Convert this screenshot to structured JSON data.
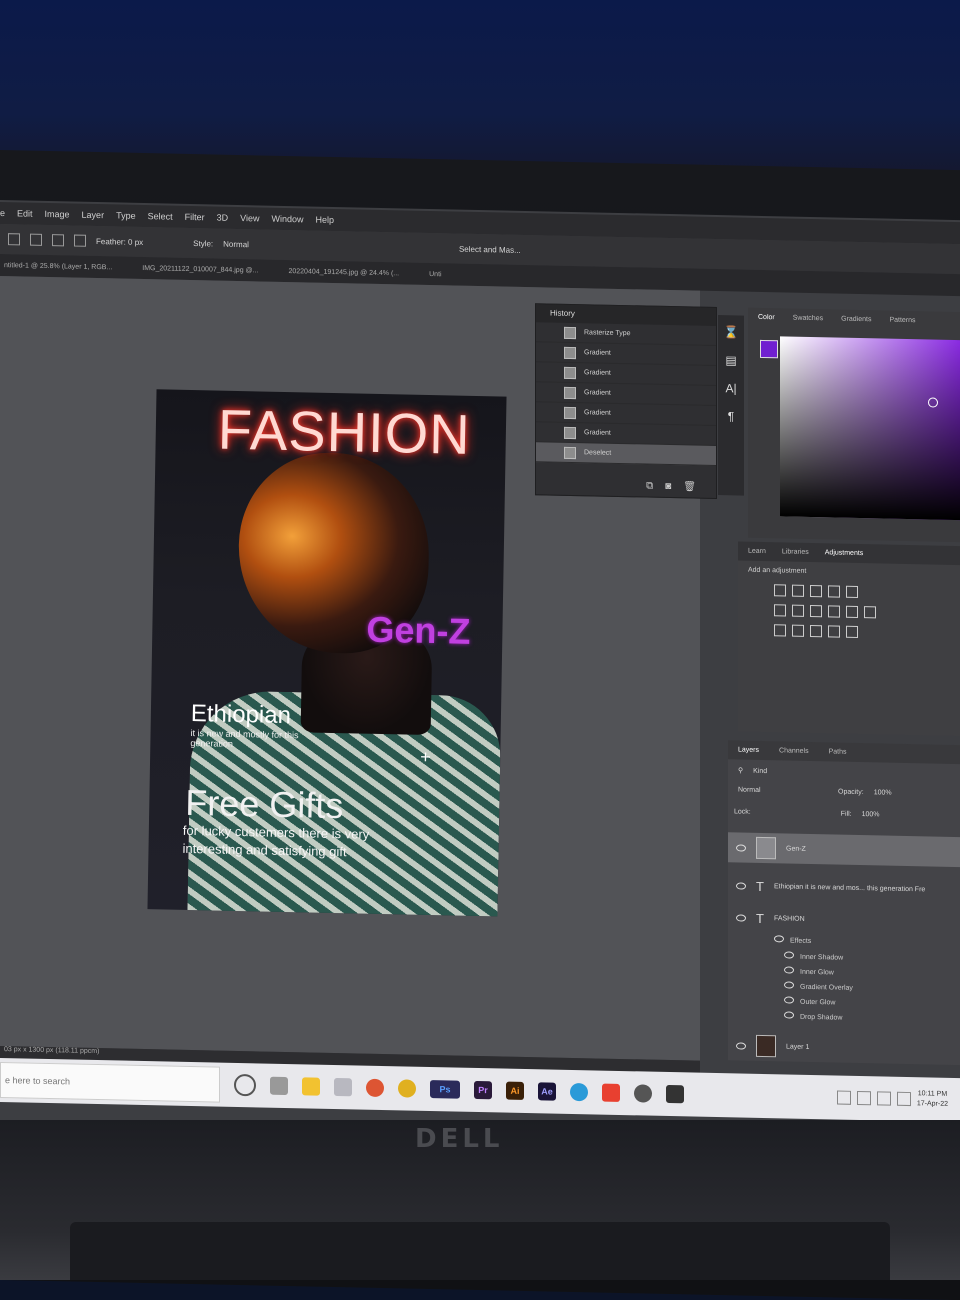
{
  "menu": [
    "e",
    "Edit",
    "Image",
    "Layer",
    "Type",
    "Select",
    "Filter",
    "3D",
    "View",
    "Window",
    "Help"
  ],
  "options": {
    "feather": "Feather:  0 px",
    "style": "Style:",
    "style_value": "Normal",
    "select_mask": "Select and Mas..."
  },
  "doc_tabs": [
    "ntitled-1 @ 25.8% (Layer 1, RGB...",
    "IMG_20211122_010007_844.jpg @...",
    "20220404_191245.jpg @ 24.4% (...",
    "Unti"
  ],
  "history": {
    "title": "History",
    "items": [
      "Rasterize Type",
      "Gradient",
      "Gradient",
      "Gradient",
      "Gradient",
      "Gradient",
      "Deselect"
    ],
    "active_index": 6
  },
  "color_panel": {
    "tabs": [
      "Color",
      "Swatches",
      "Gradients",
      "Patterns"
    ],
    "foreground": "#7020d0"
  },
  "adjustments": {
    "tabs": [
      "Learn",
      "Libraries",
      "Adjustments"
    ],
    "active": "Adjustments",
    "label": "Add an adjustment"
  },
  "layers": {
    "tabs": [
      "Layers",
      "Channels",
      "Paths"
    ],
    "filter_kind": "Kind",
    "blend_mode": "Normal",
    "opacity_label": "Opacity:",
    "opacity": "100%",
    "lock_label": "Lock:",
    "fill_label": "Fill:",
    "fill": "100%",
    "items": [
      {
        "name": "Gen-Z",
        "type": "image"
      },
      {
        "name": "Ethiopian  it is new and mos... this generation  Fre",
        "type": "text"
      },
      {
        "name": "FASHION",
        "type": "text"
      },
      {
        "name": "Layer 1",
        "type": "image"
      }
    ],
    "effects_label": "Effects",
    "effects": [
      "Inner Shadow",
      "Inner Glow",
      "Gradient Overlay",
      "Outer Glow",
      "Drop Shadow"
    ]
  },
  "poster": {
    "title": "FASHION",
    "tag": "Gen-Z",
    "heading1": "Ethiopian",
    "sub1": "it is new and mostly for this generation",
    "heading2": "Free Gifts",
    "sub2": "for lucky custemers there is very interesting and satisfying gift"
  },
  "status": "03 px x 1300 px (118.11 ppcm)",
  "taskbar": {
    "search_placeholder": "e here to search",
    "apps": [
      "Ps",
      "Pr",
      "Ai",
      "Ae"
    ],
    "time": "10:11 PM",
    "date": "17-Apr-22"
  },
  "monitor_brand": "DELL"
}
